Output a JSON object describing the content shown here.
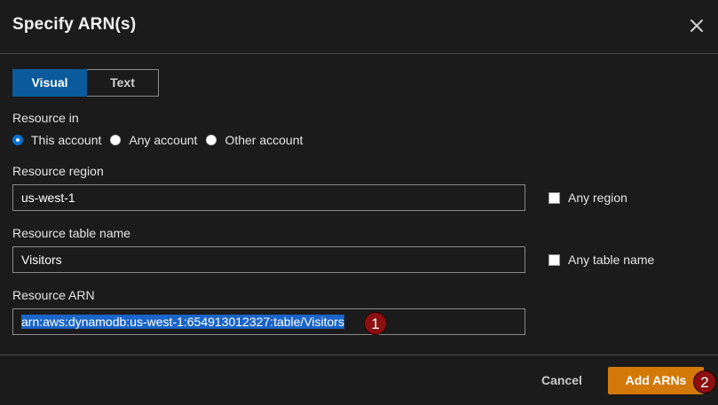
{
  "dialog": {
    "title": "Specify ARN(s)",
    "close_icon": "close-icon"
  },
  "tabs": [
    {
      "label": "Visual",
      "active": true
    },
    {
      "label": "Text",
      "active": false
    }
  ],
  "resource_in": {
    "label": "Resource in",
    "options": [
      {
        "label": "This account",
        "checked": true
      },
      {
        "label": "Any account",
        "checked": false
      },
      {
        "label": "Other account",
        "checked": false
      }
    ]
  },
  "region": {
    "label": "Resource region",
    "value": "us-west-1",
    "checkbox_label": "Any region"
  },
  "table_name": {
    "label": "Resource table name",
    "value": "Visitors",
    "checkbox_label": "Any table name"
  },
  "arn": {
    "label": "Resource ARN",
    "value": "arn:aws:dynamodb:us-west-1:654913012327:table/Visitors"
  },
  "footer": {
    "cancel_label": "Cancel",
    "add_label": "Add ARNs"
  },
  "annotations": [
    "1",
    "2"
  ],
  "colors": {
    "primary": "#d3790a",
    "tab_active": "#0a5a9c",
    "marker": "#8c1010",
    "selection": "#1a64c8"
  }
}
